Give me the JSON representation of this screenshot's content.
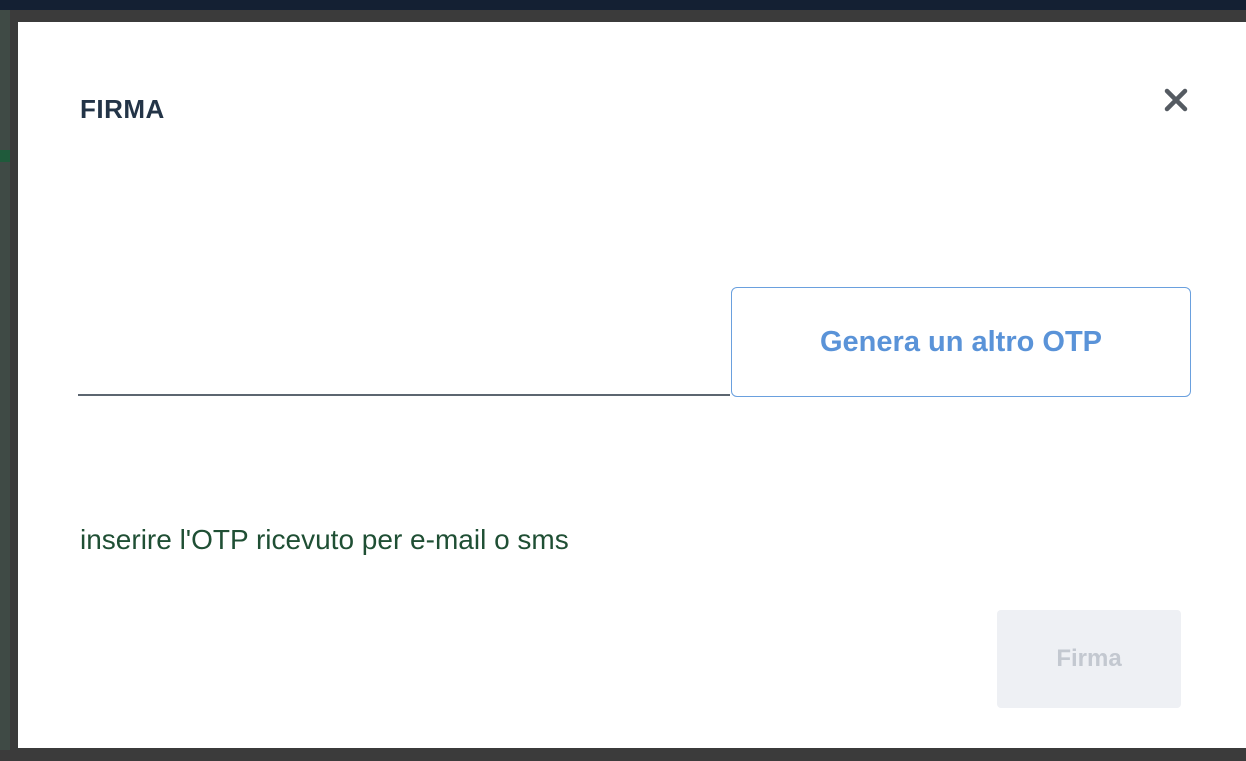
{
  "modal": {
    "title": "FIRMA",
    "close_icon": "close-icon"
  },
  "otp_input": {
    "value": "",
    "placeholder": ""
  },
  "regenerate_button": {
    "label": "Genera un altro OTP"
  },
  "helper_text": "inserire l'OTP ricevuto per e-mail o sms",
  "sign_button": {
    "label": "Firma",
    "disabled": true
  },
  "colors": {
    "title": "#233447",
    "accent_blue": "#5a93d8",
    "helper_green": "#1f4f34",
    "disabled_bg": "#eef0f4",
    "disabled_text": "#c3c8d0",
    "backdrop": "#3b3b3b"
  }
}
